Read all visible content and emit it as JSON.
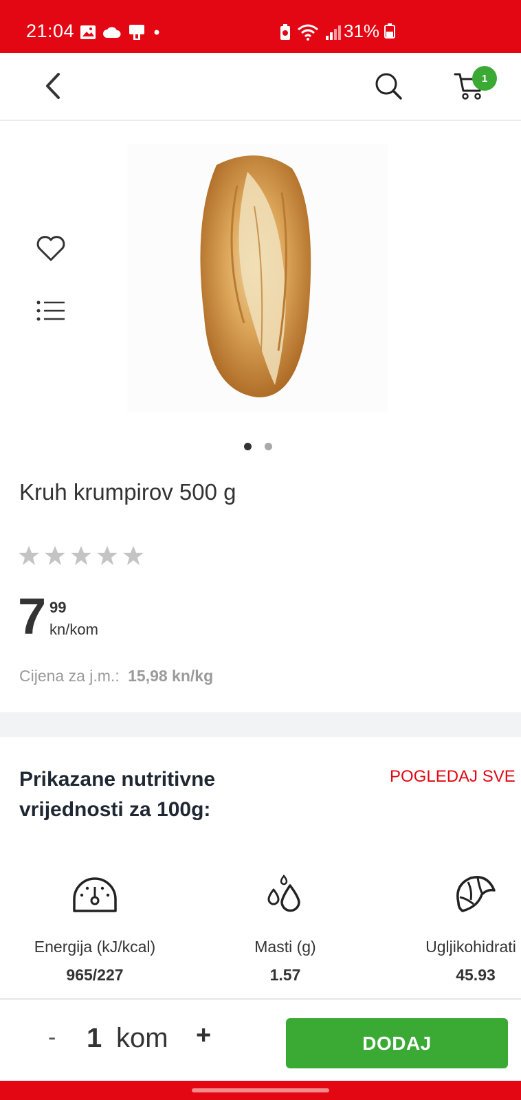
{
  "status_bar": {
    "time": "21:04",
    "battery": "31%",
    "bg_color": "#e30613"
  },
  "topbar": {
    "back_icon": "chevron-left-icon",
    "search_icon": "search-icon",
    "cart_icon": "cart-icon",
    "cart_count": "1"
  },
  "product": {
    "name": "Kruh krumpirov 500 g",
    "image": "bread-loaf",
    "gallery_count": 2,
    "gallery_active": 1,
    "rating": 0,
    "rating_max": 5,
    "price_main": "7",
    "price_cents": "99",
    "price_unit": "kn/kom",
    "unit_price_label": "Cijena za j.m.:",
    "unit_price_value": "15,98 kn/kg"
  },
  "side_actions": {
    "favorite_icon": "heart-icon",
    "list_icon": "list-icon"
  },
  "nutrition": {
    "title": "Prikazane nutritivne vrijednosti za 100g:",
    "view_all": "POGLEDAJ SVE",
    "items": [
      {
        "label": "Energija (kJ/kcal)",
        "value": "965/227",
        "icon": "gauge-icon"
      },
      {
        "label": "Masti (g)",
        "value": "1.57",
        "icon": "drops-icon"
      },
      {
        "label": "Ugljikohidrati (",
        "value": "45.93",
        "icon": "croissant-icon"
      }
    ]
  },
  "cart_bar": {
    "minus": "-",
    "quantity": "1",
    "unit": "kom",
    "plus": "+",
    "add_label": "DODAJ",
    "add_color": "#3aaa35"
  }
}
